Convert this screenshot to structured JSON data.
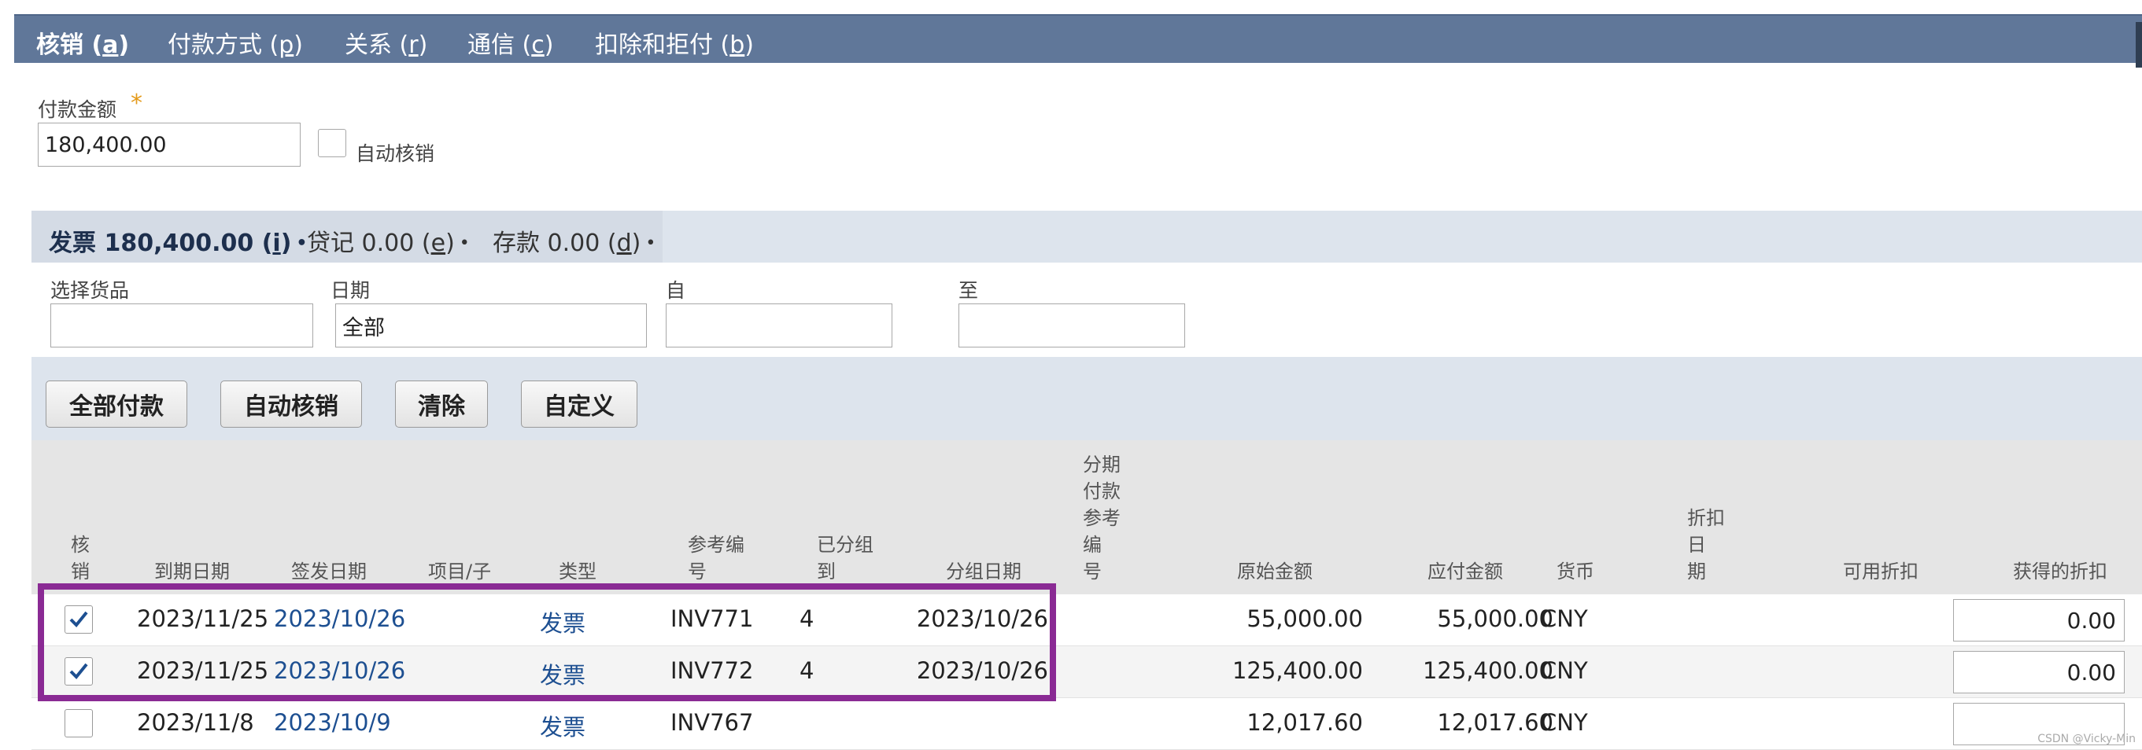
{
  "tabs": [
    {
      "label": "核销",
      "key": "a",
      "active": true
    },
    {
      "label": "付款方式",
      "key": "p"
    },
    {
      "label": "关系",
      "key": "r"
    },
    {
      "label": "通信",
      "key": "c"
    },
    {
      "label": "扣除和拒付",
      "key": "b"
    }
  ],
  "payment": {
    "amount_label": "付款金额",
    "required_mark": "*",
    "amount_value": "180,400.00",
    "auto_apply_label": "自动核销"
  },
  "subtabs": [
    {
      "label": "发票",
      "amount": "180,400.00",
      "key": "i",
      "active": true
    },
    {
      "label": "贷记",
      "amount": "0.00",
      "key": "e"
    },
    {
      "label": "存款",
      "amount": "0.00",
      "key": "d"
    }
  ],
  "filters": {
    "item_label": "选择货品",
    "item_value": "",
    "date_label": "日期",
    "date_value": "全部",
    "from_label": "自",
    "from_value": "",
    "to_label": "至",
    "to_value": ""
  },
  "buttons": {
    "pay_all": "全部付款",
    "auto_apply": "自动核销",
    "clear": "清除",
    "customize": "自定义"
  },
  "columns": {
    "apply": "核\n销",
    "due_date": "到期日期",
    "issue_date": "签发日期",
    "item": "项目/子",
    "type": "类型",
    "ref_no": "参考编\n号",
    "grouped": "已分组\n到",
    "group_date": "分组日期",
    "installment_ref": "分期\n付款\n参考\n编\n号",
    "orig_amount": "原始金额",
    "amount_due": "应付金额",
    "currency": "货币",
    "disc_date": "折扣\n日\n期",
    "disc_avail": "可用折扣",
    "disc_taken": "获得的折扣"
  },
  "rows": [
    {
      "checked": true,
      "due_date": "2023/11/25",
      "issue_date": "2023/10/26",
      "type": "发票",
      "ref_no": "INV771",
      "grouped": "4",
      "group_date": "2023/10/26",
      "orig_amount": "55,000.00",
      "amount_due": "55,000.00",
      "currency": "CNY",
      "disc_taken": "0.00"
    },
    {
      "checked": true,
      "due_date": "2023/11/25",
      "issue_date": "2023/10/26",
      "type": "发票",
      "ref_no": "INV772",
      "grouped": "4",
      "group_date": "2023/10/26",
      "orig_amount": "125,400.00",
      "amount_due": "125,400.00",
      "currency": "CNY",
      "disc_taken": "0.00"
    },
    {
      "checked": false,
      "due_date": "2023/11/8",
      "issue_date": "2023/10/9",
      "type": "发票",
      "ref_no": "INV767",
      "grouped": "",
      "group_date": "",
      "orig_amount": "12,017.60",
      "amount_due": "12,017.60",
      "currency": "CNY",
      "disc_taken": ""
    }
  ],
  "watermark": "CSDN @Vicky-Min",
  "colors": {
    "tabbar": "#607799",
    "link": "#1d4f91",
    "highlight": "#8a2a94",
    "section": "#dde4ed"
  }
}
